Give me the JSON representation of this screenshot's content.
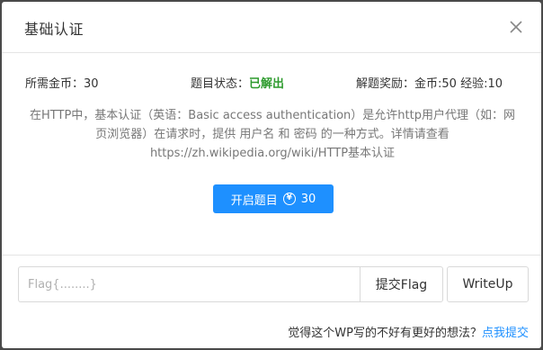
{
  "modal": {
    "title": "基础认证"
  },
  "stats": {
    "coins_label": "所需金币：",
    "coins_value": "30",
    "status_label": "题目状态：",
    "status_value": "已解出",
    "reward_label": "解题奖励：",
    "reward_value": "金币:50 经验:10"
  },
  "description": {
    "line1": "在HTTP中，基本认证（英语：Basic access authentication）是允许http用户代理（如：网",
    "line2": "页浏览器）在请求时，提供 用户名 和 密码 的一种方式。详情请查看",
    "line3": "https://zh.wikipedia.org/wiki/HTTP基本认证"
  },
  "start_button": {
    "label": "开启题目",
    "coin_glyph": "¥",
    "cost": "30"
  },
  "flag_form": {
    "placeholder": "Flag{........}",
    "value": "",
    "submit_label": "提交Flag",
    "writeup_label": "WriteUp"
  },
  "feedback": {
    "prompt": "觉得这个WP写的不好有更好的想法？",
    "link_label": "点我提交"
  },
  "colors": {
    "accent": "#1e90ff",
    "solved": "#2e9b2e"
  }
}
